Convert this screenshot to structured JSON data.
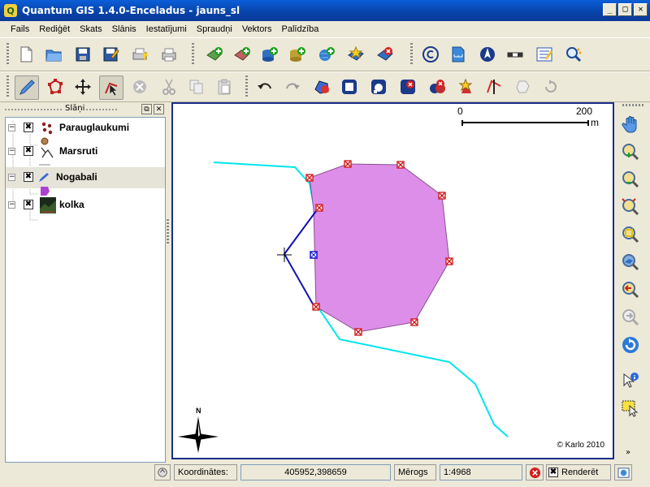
{
  "window": {
    "title": "Quantum GIS 1.4.0-Enceladus - jauns_sl",
    "app_icon": "Q"
  },
  "menu": [
    "Fails",
    "Rediģēt",
    "Skats",
    "Slānis",
    "Iestatījumi",
    "Spraudņi",
    "Vektors",
    "Palīdzība"
  ],
  "layers_panel": {
    "title": "Slāņi",
    "layers": [
      {
        "name": "Parauglaukumi",
        "checked": "✖",
        "selected": false
      },
      {
        "name": "Marsruti",
        "checked": "✖",
        "selected": false
      },
      {
        "name": "Nogabali",
        "checked": "✖",
        "selected": true
      },
      {
        "name": "kolka",
        "checked": "✖",
        "selected": false
      }
    ],
    "toggle_symbol": "−"
  },
  "map": {
    "scale": {
      "start": "0",
      "end": "200",
      "unit": "m"
    },
    "north": "N",
    "copyright": "© Karlo 2010",
    "polygon_fill": "#dd8ee8",
    "river_color": "#00e5ee",
    "edit_line_color": "#1010b0"
  },
  "status": {
    "coords_label": "Koordinātes:",
    "coords_value": "405952,398659",
    "scale_label": "Mērogs",
    "scale_value": "1:4968",
    "render_label": "Renderēt"
  }
}
